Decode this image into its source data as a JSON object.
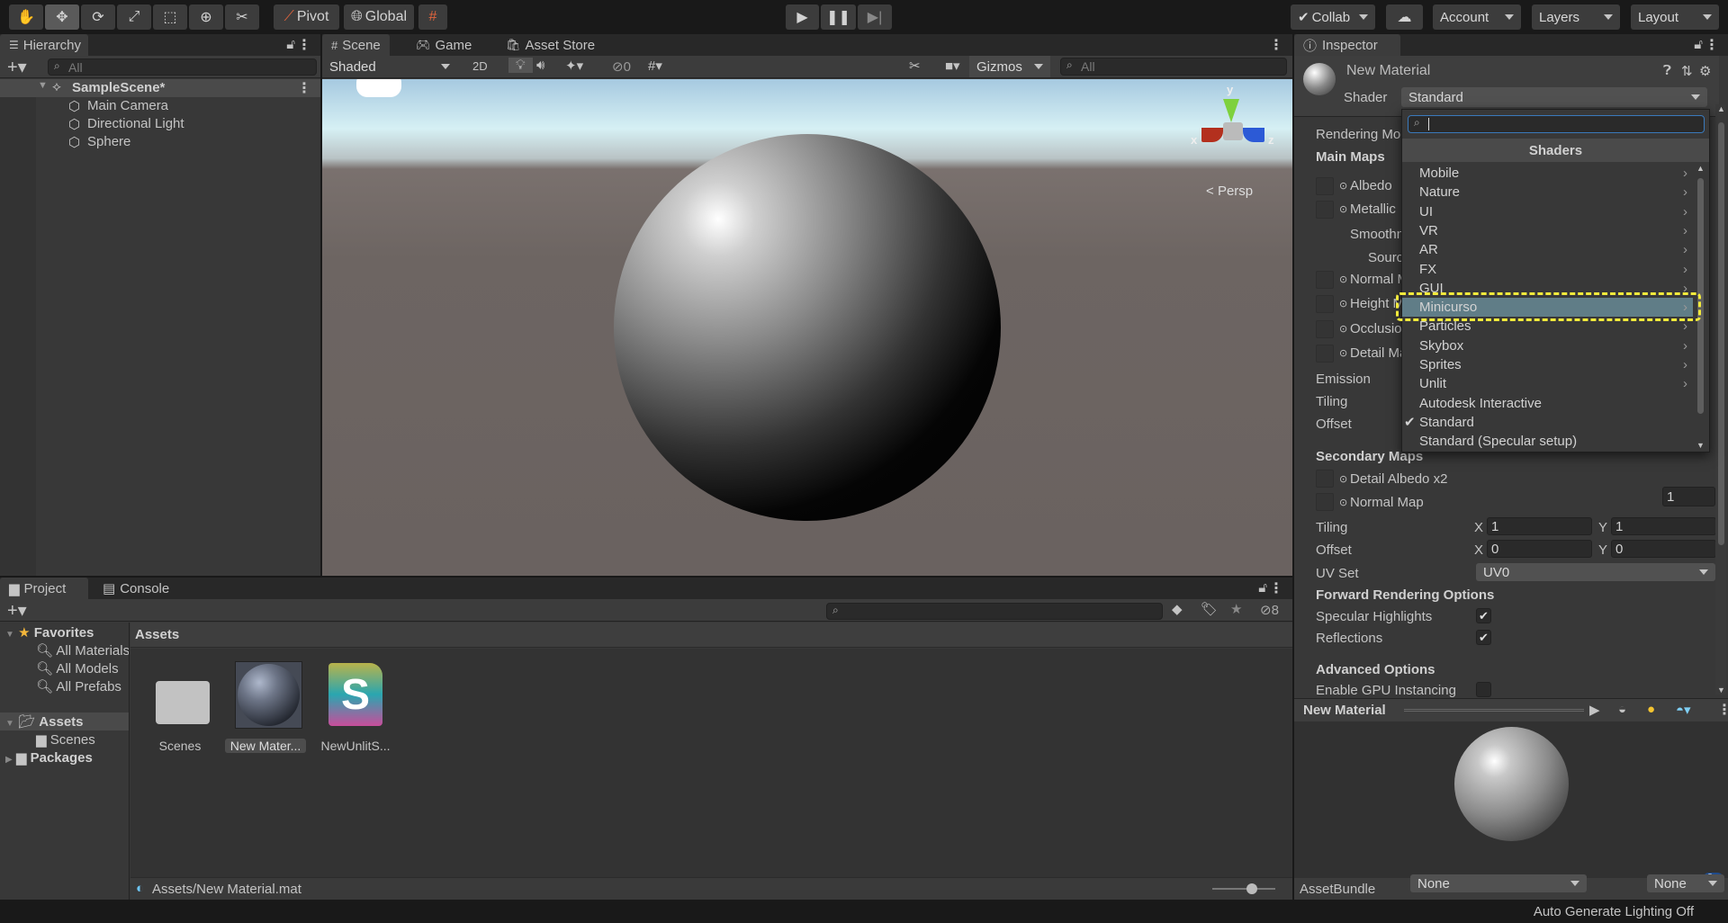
{
  "toolbar": {
    "tools": [
      {
        "icon": "hand-icon",
        "glyph": "✋"
      },
      {
        "icon": "move-icon",
        "glyph": "✥",
        "active": true
      },
      {
        "icon": "rotate-icon",
        "glyph": "⟳"
      },
      {
        "icon": "scale-icon",
        "glyph": "⤢"
      },
      {
        "icon": "rect-icon",
        "glyph": "⬚"
      },
      {
        "icon": "transform-icon",
        "glyph": "⊕"
      },
      {
        "icon": "custom-tool-icon",
        "glyph": "✂"
      }
    ],
    "pivot": "Pivot",
    "global": "Global",
    "collab": "Collab",
    "account": "Account",
    "layers": "Layers",
    "layout": "Layout"
  },
  "hierarchy": {
    "tab": "Hierarchy",
    "search_placeholder": "All",
    "scene": "SampleScene*",
    "items": [
      "Main Camera",
      "Directional Light",
      "Sphere"
    ]
  },
  "scene": {
    "tabs": [
      "Scene",
      "Game",
      "Asset Store"
    ],
    "shading": "Shaded",
    "mode_2d": "2D",
    "hidden_count": "0",
    "gizmos": "Gizmos",
    "search_placeholder": "All",
    "persp": "Persp",
    "axis": {
      "x": "x",
      "y": "y",
      "z": "z"
    }
  },
  "project": {
    "tabs": [
      "Project",
      "Console"
    ],
    "hidden_count": "8",
    "favorites": "Favorites",
    "favorite_items": [
      "All Materials",
      "All Models",
      "All Prefabs"
    ],
    "assets_root": "Assets",
    "assets_children": [
      "Scenes"
    ],
    "packages": "Packages",
    "breadcrumb": "Assets",
    "grid": [
      {
        "label": "Scenes",
        "type": "folder"
      },
      {
        "label": "New Mater...",
        "type": "material",
        "selected": true
      },
      {
        "label": "NewUnlitS...",
        "type": "shader"
      }
    ],
    "path": "Assets/New Material.mat"
  },
  "inspector": {
    "tab": "Inspector",
    "title": "New Material",
    "shader_label": "Shader",
    "shader_value": "Standard",
    "rendering_mode": "Rendering Mode",
    "main_maps": "Main Maps",
    "main_rows": [
      "Albedo",
      "Metallic",
      "Normal Map",
      "Height Map",
      "Occlusion",
      "Detail Mask"
    ],
    "smoothness": "Smoothness",
    "source": "Source",
    "emission": "Emission",
    "tiling": "Tiling",
    "offset": "Offset",
    "secondary_maps": "Secondary Maps",
    "detail_albedo": "Detail Albedo x2",
    "normal_map": "Normal Map",
    "normal_scale": "1",
    "tiling2": {
      "label": "Tiling",
      "x": "1",
      "y": "1"
    },
    "offset2": {
      "label": "Offset",
      "x": "0",
      "y": "0"
    },
    "axis_x": "X",
    "axis_y": "Y",
    "uv_set": "UV Set",
    "uv_value": "UV0",
    "forward": "Forward Rendering Options",
    "specular": "Specular Highlights",
    "specular_on": true,
    "reflections": "Reflections",
    "reflections_on": true,
    "advanced": "Advanced Options",
    "gpu": "Enable GPU Instancing",
    "gpu_on": false,
    "preview_title": "New Material",
    "assetbundle": "AssetBundle",
    "bundle_value": "None",
    "variant_value": "None"
  },
  "shader_menu": {
    "header": "Shaders",
    "items": [
      {
        "label": "Mobile",
        "sub": true
      },
      {
        "label": "Nature",
        "sub": true
      },
      {
        "label": "UI",
        "sub": true
      },
      {
        "label": "VR",
        "sub": true
      },
      {
        "label": "AR",
        "sub": true
      },
      {
        "label": "FX",
        "sub": true
      },
      {
        "label": "GUI",
        "sub": true
      },
      {
        "label": "Minicurso",
        "sub": true,
        "highlighted": true
      },
      {
        "label": "Particles",
        "sub": true
      },
      {
        "label": "Skybox",
        "sub": true
      },
      {
        "label": "Sprites",
        "sub": true
      },
      {
        "label": "Unlit",
        "sub": true
      },
      {
        "label": "Autodesk Interactive",
        "sub": false
      },
      {
        "label": "Standard",
        "sub": false,
        "checked": true
      },
      {
        "label": "Standard (Specular setup)",
        "sub": false
      }
    ],
    "highlight_color": "#607d87",
    "annotation_color": "#f2ea3c"
  },
  "status": {
    "lighting": "Auto Generate Lighting Off"
  }
}
